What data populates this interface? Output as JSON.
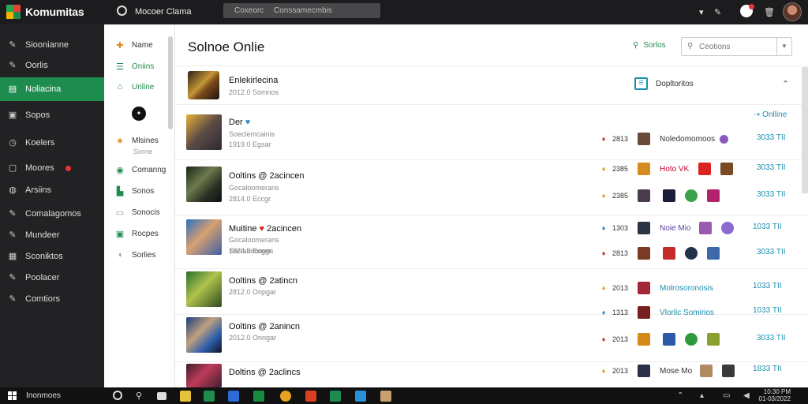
{
  "topbar": {
    "app_name": "Komumitas",
    "title": "Mocoer Clama",
    "search_left": "Coxeorc",
    "search_right": "Conssamecmbis"
  },
  "sidebar": {
    "items": [
      {
        "label": "Sioonianne",
        "icon": "pin-icon"
      },
      {
        "label": "Oorlis",
        "icon": "pin-icon"
      },
      {
        "label": "Noliacina",
        "icon": "newsfeed-icon",
        "active": true
      },
      {
        "label": "Sopos",
        "icon": "document-icon"
      },
      {
        "label": "Koelers",
        "icon": "clock-icon"
      },
      {
        "label": "Moores",
        "icon": "window-icon",
        "badge": true
      },
      {
        "label": "Arsiins",
        "icon": "globe-icon"
      },
      {
        "label": "Comalagomos",
        "icon": "pin-icon"
      },
      {
        "label": "Mundeer",
        "icon": "pin-icon"
      },
      {
        "label": "Sconiktos",
        "icon": "grid-icon"
      },
      {
        "label": "Poolacer",
        "icon": "pin-icon"
      },
      {
        "label": "Comtiors",
        "icon": "pin-icon"
      }
    ]
  },
  "subnav": {
    "items": [
      {
        "label": "Name",
        "icon": "puzzle-icon",
        "color": "#e08a1e"
      },
      {
        "label": "Oniins",
        "icon": "lines-icon",
        "color": "#1e8c4e"
      },
      {
        "label": "Unline",
        "icon": "home-icon",
        "color": "#1e8c4e"
      },
      {
        "label": "Mlsines",
        "icon": "star-icon",
        "color": "#e08a1e"
      },
      {
        "label": "Comanng",
        "icon": "badge-icon",
        "color": "#1e8c4e"
      },
      {
        "label": "Sonos",
        "icon": "briefcase-icon",
        "color": "#1e8c4e"
      },
      {
        "label": "Sonocis",
        "icon": "page-icon",
        "color": "#999999"
      },
      {
        "label": "Rocpes",
        "icon": "chat-icon",
        "color": "#1e8c4e"
      },
      {
        "label": "Sorlies",
        "icon": "shield-icon",
        "color": "#999999"
      }
    ],
    "sub_label": "Sorne"
  },
  "main": {
    "title": "Solnoe Onlie",
    "sort_label": "Sorlos",
    "search_placeholder": "Ceotions",
    "header_card": {
      "title": "Enlekirlecina",
      "subtitle": "2012.0 Somnos",
      "filter_label": "Dopltoritos"
    },
    "online_label": "Onlline",
    "rows": [
      {
        "title": "Der",
        "title_extra_icon": "blue-dot",
        "sub": "Soeclemcainis",
        "time": "1919.0 Egsar",
        "stats": [
          {
            "medal": "2813",
            "heroes_text": "Noledomomoos",
            "tier": "3033 TII"
          }
        ]
      },
      {
        "title": "Ooltins @ 2acincen",
        "sub": "Gocaloomerans",
        "time": "2814.0 Eccgr",
        "stats": [
          {
            "medal": "2385",
            "heroes_text": "Hoto VK",
            "tier": "3033 TII"
          },
          {
            "medal": "2385",
            "heroes_text": "",
            "tier": "3033 TII"
          }
        ]
      },
      {
        "title": "Muitine",
        "title_extra": "2acincen",
        "sub": "Gocaloomerans",
        "time": "1924.0 Enggr",
        "stats": [
          {
            "medal": "1303",
            "heroes_text": "Noie Mio",
            "tier": "1033 TII"
          },
          {
            "medal": "2813",
            "heroes_text": "",
            "tier": "3033 TII"
          }
        ]
      },
      {
        "title": "Ooltins @ 2atincn",
        "sub": "Socialomoons",
        "time": "2812.0 Onpgar",
        "stats": [
          {
            "medal": "2013",
            "heroes_text": "Molrosoronosis",
            "tier": "1033 TII"
          },
          {
            "medal": "1313",
            "heroes_text": "Vlorlic Somirios",
            "tier": "1033 TII"
          }
        ]
      },
      {
        "title": "Ooltins @ 2anincn",
        "sub": "",
        "time": "2012.0 Onngar",
        "stats": [
          {
            "medal": "2013",
            "heroes_text": "",
            "tier": "3033 TII"
          }
        ]
      },
      {
        "title": "Doltins @ 2aclincs",
        "sub": "",
        "time": "",
        "stats": [
          {
            "medal": "2013",
            "heroes_text": "Mose Mo",
            "tier": "1833 TII"
          }
        ]
      }
    ]
  },
  "taskbar": {
    "label": "Inonmoes",
    "clock_time": "10:30 PM",
    "clock_date": "01-03/2022"
  },
  "colors": {
    "accent": "#1e8c4e",
    "link": "#1b8fb0",
    "sidebar_bg": "#222224",
    "topbar_bg": "#1c1c1e"
  }
}
